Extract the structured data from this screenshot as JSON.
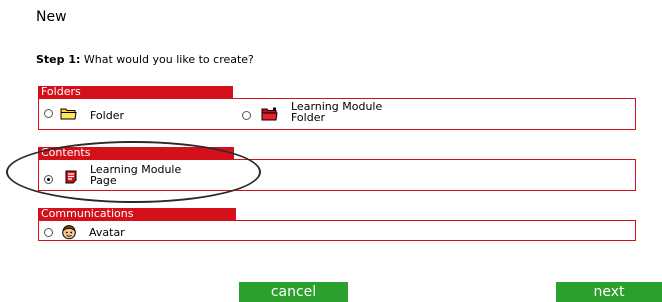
{
  "page": {
    "title": "New"
  },
  "step": {
    "label": "Step 1:",
    "question": "What would you like to create?"
  },
  "sections": {
    "folders": {
      "title": "Folders",
      "options": {
        "folder": {
          "label": "Folder",
          "icon": "folder-icon",
          "selected": false
        },
        "lm_folder": {
          "label_line1": "Learning Module",
          "label_line2": "Folder",
          "icon": "red-folder-icon",
          "selected": false
        }
      }
    },
    "contents": {
      "title": "Contents",
      "options": {
        "lm_page": {
          "label_line1": "Learning Module",
          "label_line2": "Page",
          "icon": "page-icon",
          "selected": true
        }
      }
    },
    "communications": {
      "title": "Communications",
      "options": {
        "avatar": {
          "label": "Avatar",
          "icon": "avatar-icon",
          "selected": false
        }
      }
    }
  },
  "buttons": {
    "cancel": "cancel",
    "next": "next"
  },
  "colors": {
    "accent_red": "#d4111b",
    "button_green": "#2ca02c"
  }
}
